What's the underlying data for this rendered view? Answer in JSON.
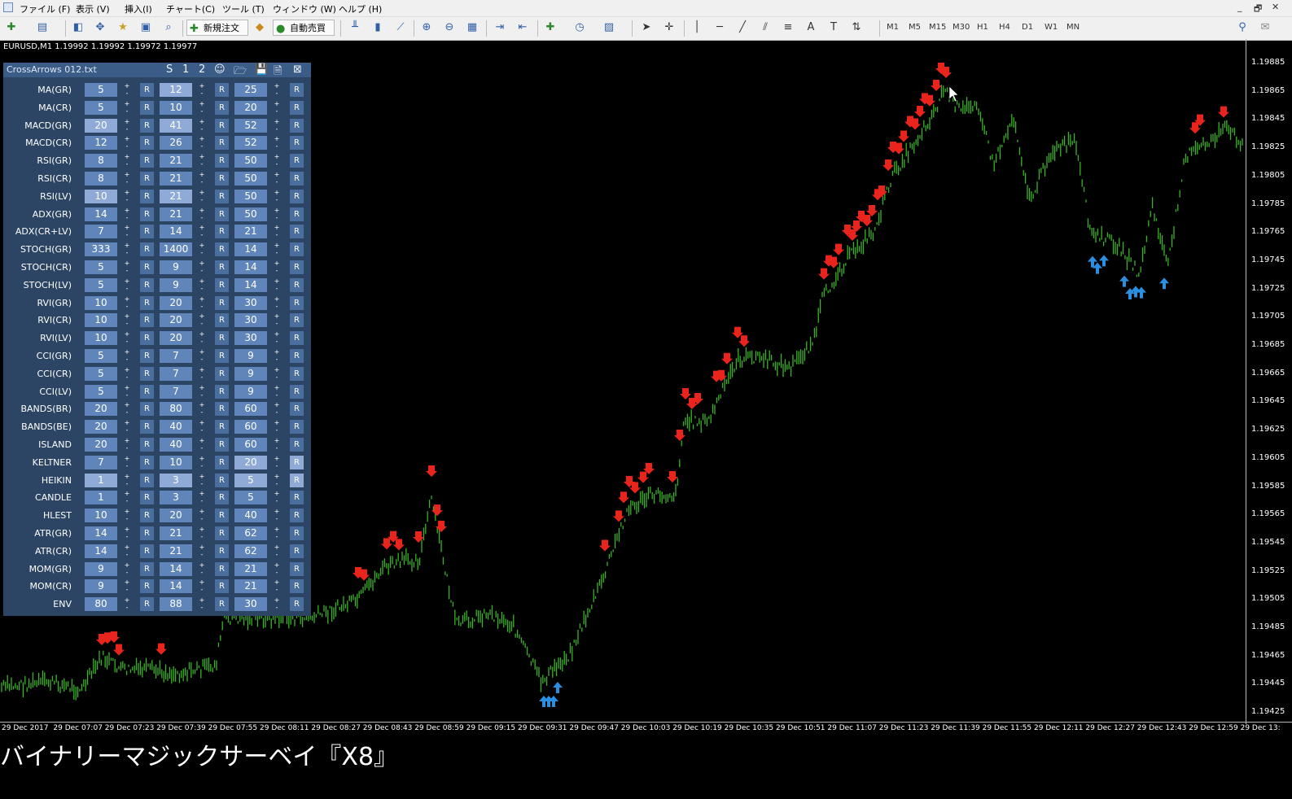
{
  "menu": [
    "ファイル (F)",
    "表示 (V)",
    "挿入(I)",
    "チャート(C)",
    "ツール (T)",
    "ウィンドウ (W)",
    "ヘルプ (H)"
  ],
  "window_controls": [
    "_",
    "🗗",
    "✕"
  ],
  "toolbar": {
    "new_order_label": "新規注文",
    "auto_trade_label": "自動売買",
    "timeframes": [
      "M1",
      "M5",
      "M15",
      "M30",
      "H1",
      "H4",
      "D1",
      "W1",
      "MN"
    ]
  },
  "chart": {
    "title": "EURUSD,M1  1.19992 1.19992 1.19972 1.19977",
    "price_labels": [
      "1.19885",
      "1.19865",
      "1.19845",
      "1.19825",
      "1.19805",
      "1.19785",
      "1.19765",
      "1.19745",
      "1.19725",
      "1.19705",
      "1.19685",
      "1.19665",
      "1.19645",
      "1.19625",
      "1.19605",
      "1.19585",
      "1.19565",
      "1.19545",
      "1.19525",
      "1.19505",
      "1.19485",
      "1.19465",
      "1.19445",
      "1.19425"
    ],
    "time_labels": [
      "29 Dec 2017",
      "29 Dec 07:07",
      "29 Dec 07:23",
      "29 Dec 07:39",
      "29 Dec 07:55",
      "29 Dec 08:11",
      "29 Dec 08:27",
      "29 Dec 08:43",
      "29 Dec 08:59",
      "29 Dec 09:15",
      "29 Dec 09:31",
      "29 Dec 09:47",
      "29 Dec 10:03",
      "29 Dec 10:19",
      "29 Dec 10:35",
      "29 Dec 10:51",
      "29 Dec 11:07",
      "29 Dec 11:23",
      "29 Dec 11:39",
      "29 Dec 11:55",
      "29 Dec 12:11",
      "29 Dec 12:27",
      "29 Dec 12:43",
      "29 Dec 12:59",
      "29 Dec 13:"
    ],
    "colors": {
      "background": "#000000",
      "candle": "#39b324",
      "sell_arrow": "#e8241c",
      "buy_arrow": "#2a8fe0"
    }
  },
  "panel": {
    "title": "CrossArrows  012.txt",
    "header_icons": [
      "S",
      "1",
      "2",
      "☺",
      "🗁",
      "💾",
      "🗎",
      "⊠"
    ],
    "r_label": "R",
    "rows": [
      {
        "label": "MA(GR)",
        "v": [
          "5",
          "12",
          "25"
        ]
      },
      {
        "label": "MA(CR)",
        "v": [
          "5",
          "10",
          "20"
        ]
      },
      {
        "label": "MACD(GR)",
        "v": [
          "20",
          "41",
          "52"
        ]
      },
      {
        "label": "MACD(CR)",
        "v": [
          "12",
          "26",
          "52"
        ]
      },
      {
        "label": "RSI(GR)",
        "v": [
          "8",
          "21",
          "50"
        ]
      },
      {
        "label": "RSI(CR)",
        "v": [
          "8",
          "21",
          "50"
        ]
      },
      {
        "label": "RSI(LV)",
        "v": [
          "10",
          "21",
          "50"
        ]
      },
      {
        "label": "ADX(GR)",
        "v": [
          "14",
          "21",
          "50"
        ]
      },
      {
        "label": "ADX(CR+LV)",
        "v": [
          "7",
          "14",
          "21"
        ]
      },
      {
        "label": "STOCH(GR)",
        "v": [
          "333",
          "1400",
          "14"
        ]
      },
      {
        "label": "STOCH(CR)",
        "v": [
          "5",
          "9",
          "14"
        ]
      },
      {
        "label": "STOCH(LV)",
        "v": [
          "5",
          "9",
          "14"
        ]
      },
      {
        "label": "RVI(GR)",
        "v": [
          "10",
          "20",
          "30"
        ]
      },
      {
        "label": "RVI(CR)",
        "v": [
          "10",
          "20",
          "30"
        ]
      },
      {
        "label": "RVI(LV)",
        "v": [
          "10",
          "20",
          "30"
        ]
      },
      {
        "label": "CCI(GR)",
        "v": [
          "5",
          "7",
          "9"
        ]
      },
      {
        "label": "CCI(CR)",
        "v": [
          "5",
          "7",
          "9"
        ]
      },
      {
        "label": "CCI(LV)",
        "v": [
          "5",
          "7",
          "9"
        ]
      },
      {
        "label": "BANDS(BR)",
        "v": [
          "20",
          "80",
          "60"
        ]
      },
      {
        "label": "BANDS(BE)",
        "v": [
          "20",
          "40",
          "60"
        ]
      },
      {
        "label": "ISLAND",
        "v": [
          "20",
          "40",
          "60"
        ]
      },
      {
        "label": "KELTNER",
        "v": [
          "7",
          "10",
          "20"
        ]
      },
      {
        "label": "HEIKIN",
        "v": [
          "1",
          "3",
          "5"
        ]
      },
      {
        "label": "CANDLE",
        "v": [
          "1",
          "3",
          "5"
        ]
      },
      {
        "label": "HLEST",
        "v": [
          "10",
          "20",
          "40"
        ]
      },
      {
        "label": "ATR(GR)",
        "v": [
          "14",
          "21",
          "62"
        ]
      },
      {
        "label": "ATR(CR)",
        "v": [
          "14",
          "21",
          "62"
        ]
      },
      {
        "label": "MOM(GR)",
        "v": [
          "9",
          "14",
          "21"
        ]
      },
      {
        "label": "MOM(CR)",
        "v": [
          "9",
          "14",
          "21"
        ]
      },
      {
        "label": "ENV",
        "v": [
          "80",
          "88",
          "30"
        ]
      }
    ]
  },
  "caption": "バイナリーマジックサーベイ『X8』"
}
